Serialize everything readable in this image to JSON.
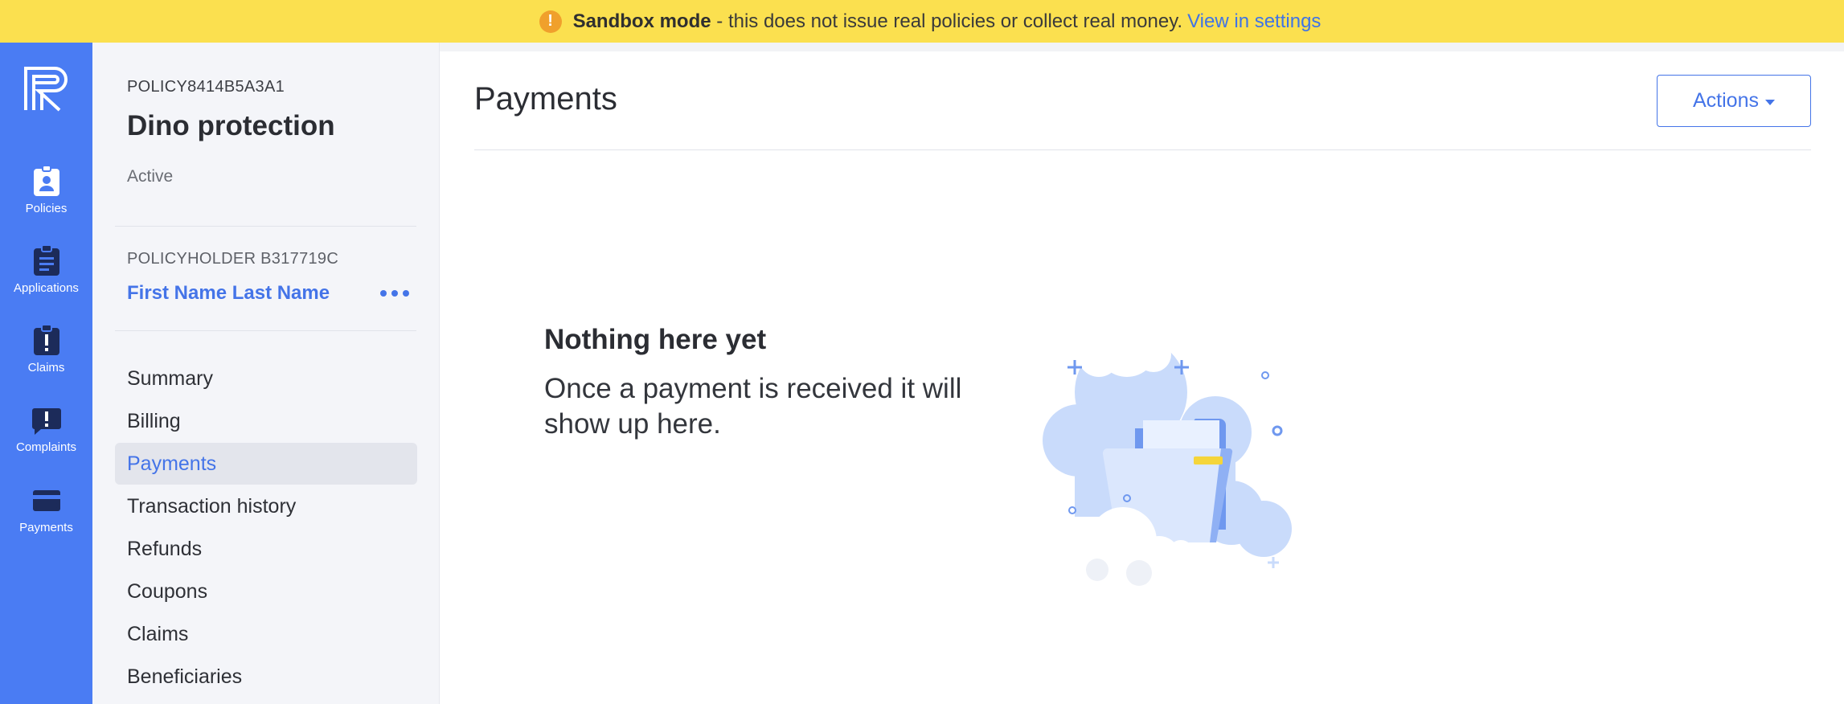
{
  "banner": {
    "icon": "warning-icon",
    "bold": "Sandbox mode",
    "text": " - this does not issue real policies or collect real money.",
    "link": "View in settings",
    "color": "#fbe04f"
  },
  "rail": {
    "color": "#4a7cf3",
    "items": [
      {
        "label": "Policies",
        "icon": "policy-badge-icon"
      },
      {
        "label": "Applications",
        "icon": "clipboard-icon"
      },
      {
        "label": "Claims",
        "icon": "claim-alert-icon"
      },
      {
        "label": "Complaints",
        "icon": "complaint-chat-icon"
      },
      {
        "label": "Payments",
        "icon": "credit-card-icon"
      }
    ]
  },
  "policy": {
    "id": "POLICY8414B5A3A1",
    "name": "Dino protection",
    "status": "Active",
    "policyholder_id": "POLICYHOLDER B317719C",
    "policyholder_name": "First Name Last Name"
  },
  "nav": {
    "items": [
      {
        "label": "Summary"
      },
      {
        "label": "Billing"
      },
      {
        "label": "Payments"
      },
      {
        "label": "Transaction history"
      },
      {
        "label": "Refunds"
      },
      {
        "label": "Coupons"
      },
      {
        "label": "Claims"
      },
      {
        "label": "Beneficiaries"
      }
    ],
    "active": "Payments"
  },
  "main": {
    "title": "Payments",
    "actions_label": "Actions",
    "empty_title": "Nothing here yet",
    "empty_text": "Once a payment is received it will show up here."
  },
  "colors": {
    "accent": "#4474e8",
    "rail": "#4a7cf3",
    "sidebar_bg": "#f4f5f9"
  }
}
